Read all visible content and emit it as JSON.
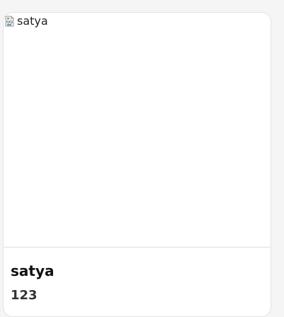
{
  "card": {
    "image_alt": "satya",
    "title": "satya",
    "subtitle": "123"
  },
  "colors": {
    "card_background": "#ffffff",
    "page_background": "#f5f5f5",
    "title_text": "#111111",
    "subtitle_text": "#333333",
    "border": "#e3e3e3"
  },
  "icons": {
    "broken_image": "broken-image-icon"
  }
}
